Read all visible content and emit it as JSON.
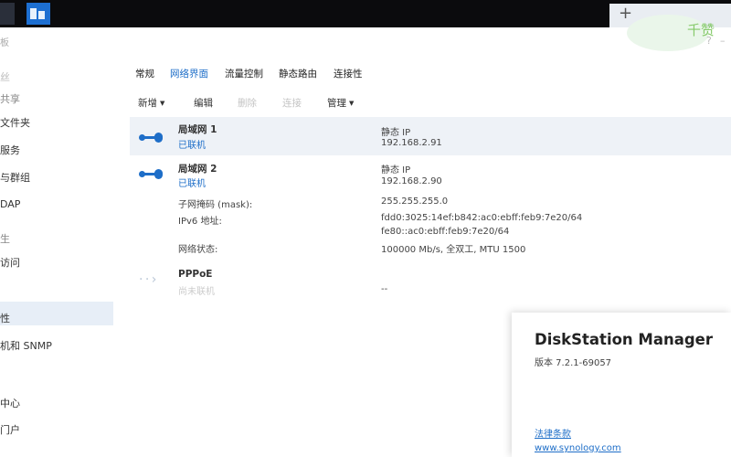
{
  "window": {
    "title": "板",
    "controls": [
      "?",
      "–"
    ]
  },
  "taskbar": {
    "plus": "+",
    "widget_text": "千赞"
  },
  "sidebar": {
    "items": [
      {
        "label": "丝",
        "style": "dim"
      },
      {
        "label": "共享",
        "style": "group"
      },
      {
        "label": "文件夹",
        "style": "normal"
      },
      {
        "label": "服务",
        "style": "normal"
      },
      {
        "label": "与群组",
        "style": "normal"
      },
      {
        "label": "DAP",
        "style": "normal"
      },
      {
        "label": "生",
        "style": "group"
      },
      {
        "label": "访问",
        "style": "normal"
      },
      {
        "label": "",
        "style": "normal"
      },
      {
        "label": "性",
        "style": "normal"
      },
      {
        "label": "机和 SNMP",
        "style": "normal"
      },
      {
        "label": "中心",
        "style": "normal"
      },
      {
        "label": "门户",
        "style": "normal"
      },
      {
        "label": "",
        "style": "normal"
      }
    ]
  },
  "tabs": [
    {
      "label": "常规"
    },
    {
      "label": "网络界面",
      "active": true
    },
    {
      "label": "流量控制"
    },
    {
      "label": "静态路由"
    },
    {
      "label": "连接性"
    }
  ],
  "toolbar": {
    "create": "新增",
    "edit": "编辑",
    "delete": "删除",
    "connect": "连接",
    "manage": "管理",
    "caret": "▼"
  },
  "interfaces": {
    "lan1": {
      "name": "局域网 1",
      "status": "已联机",
      "ip_type": "静态 IP",
      "ip": "192.168.2.91"
    },
    "lan2": {
      "name": "局域网 2",
      "status": "已联机",
      "ip_type": "静态 IP",
      "ip": "192.168.2.90",
      "mask_label": "子网掩码 (mask):",
      "mask": "255.255.255.0",
      "ipv6_label": "IPv6 地址:",
      "ipv6_1": "fdd0:3025:14ef:b842:ac0:ebff:feb9:7e20/64",
      "ipv6_2": "fe80::ac0:ebff:feb9:7e20/64",
      "state_label": "网络状态:",
      "state": "100000 Mb/s, 全双工, MTU 1500"
    },
    "pppoe": {
      "name": "PPPoE",
      "status": "尚未联机",
      "value": "--"
    }
  },
  "about": {
    "title": "DiskStation Manager",
    "version": "版本 7.2.1-69057",
    "terms": "法律条款",
    "site": "www.synology.com"
  },
  "colors": {
    "accent": "#1e6ec8",
    "selected_row": "#eef2f7",
    "taskbar": "#0b0b0d"
  }
}
